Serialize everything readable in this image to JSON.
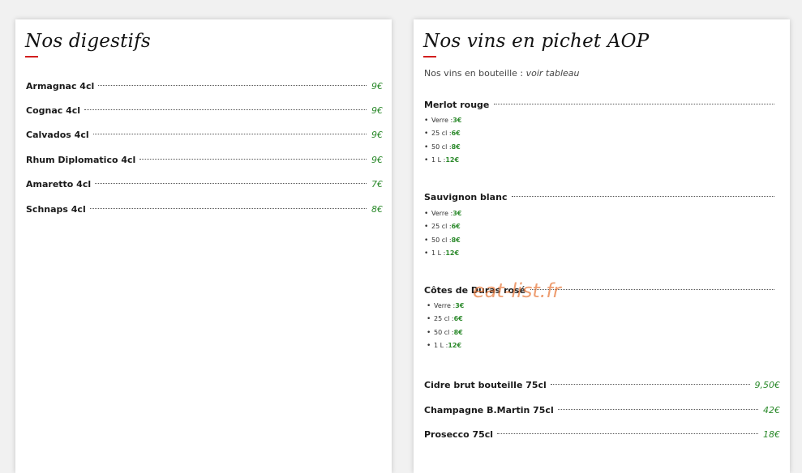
{
  "digestifs": {
    "title": "Nos digestifs",
    "items": [
      {
        "name": "Armagnac 4cl",
        "price": "9€"
      },
      {
        "name": "Cognac 4cl",
        "price": "9€"
      },
      {
        "name": "Calvados 4cl",
        "price": "9€"
      },
      {
        "name": "Rhum Diplomatico 4cl",
        "price": "9€"
      },
      {
        "name": "Amaretto 4cl",
        "price": "7€"
      },
      {
        "name": "Schnaps 4cl",
        "price": "8€"
      }
    ]
  },
  "vins": {
    "title": "Nos vins en pichet AOP",
    "intro_text": "Nos vins en bouteille : ",
    "intro_link": "voir tableau",
    "wines": [
      {
        "name": "Merlot rouge",
        "sizes": [
          {
            "label": "Verre : ",
            "price": "3€"
          },
          {
            "label": "25 cl : ",
            "price": "6€"
          },
          {
            "label": "50 cl : ",
            "price": "8€"
          },
          {
            "label": "1 L : ",
            "price": "12€"
          }
        ]
      },
      {
        "name": "Sauvignon blanc",
        "sizes": [
          {
            "label": "Verre : ",
            "price": "3€"
          },
          {
            "label": "25 cl : ",
            "price": "6€"
          },
          {
            "label": "50 cl : ",
            "price": "8€"
          },
          {
            "label": "1 L : ",
            "price": "12€"
          }
        ]
      },
      {
        "name": "Côtes de Duras rosé",
        "sizes": [
          {
            "label": "Verre : ",
            "price": "3€"
          },
          {
            "label": "25 cl : ",
            "price": "6€"
          },
          {
            "label": "50 cl : ",
            "price": "8€"
          },
          {
            "label": "1 L : ",
            "price": "12€"
          }
        ]
      }
    ],
    "bottles": [
      {
        "name": "Cidre brut bouteille 75cl",
        "price": "9,50€"
      },
      {
        "name": "Champagne B.Martin 75cl",
        "price": "42€"
      },
      {
        "name": "Prosecco 75cl",
        "price": "18€"
      }
    ]
  },
  "watermark": "eat-list.fr",
  "colors": {
    "price": "#2c8a2c",
    "accent": "#d21e1e",
    "watermark": "#e8783c"
  }
}
